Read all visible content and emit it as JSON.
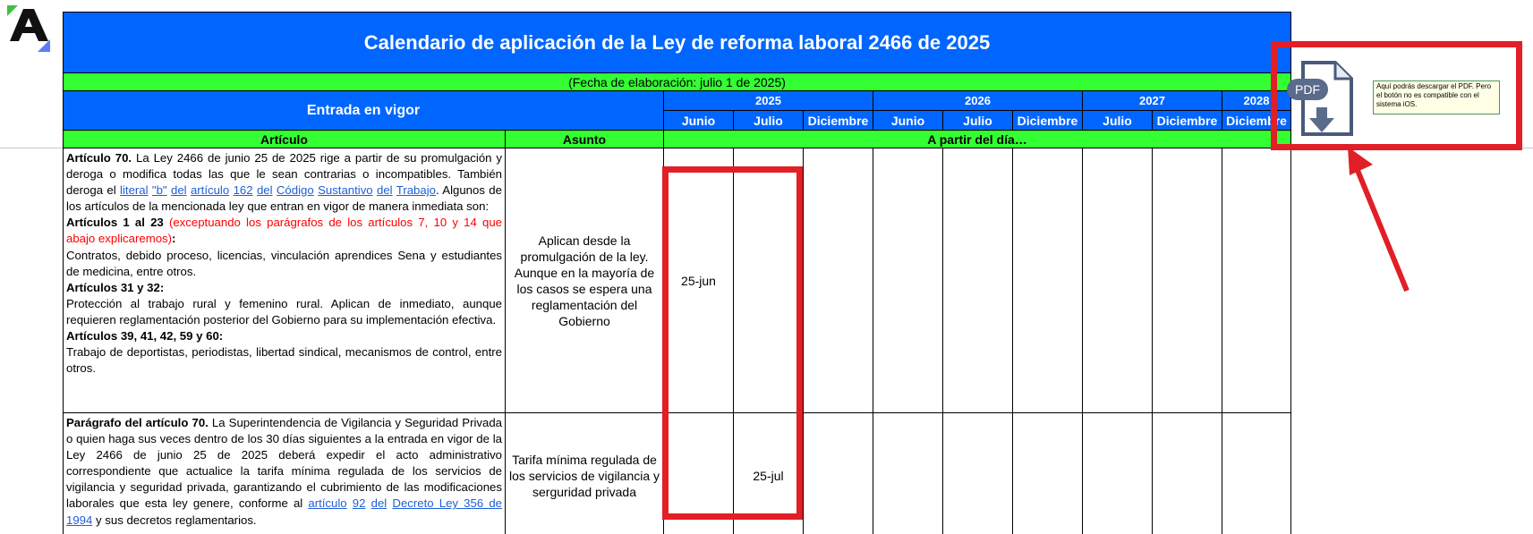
{
  "header": {
    "title": "Calendario de aplicación de la Ley de reforma laboral 2466 de 2025",
    "subtitle": "(Fecha de elaboración: julio 1 de 2025)",
    "entrada_en_vigor": "Entrada en vigor",
    "years": [
      "2025",
      "2026",
      "2027",
      "2028"
    ],
    "months": [
      "Junio",
      "Julio",
      "Diciembre",
      "Junio",
      "Julio",
      "Diciembre",
      "Julio",
      "Diciembre",
      "Diciembre"
    ],
    "col_articulo": "Artículo",
    "col_asunto": "Asunto",
    "col_a_partir": "A partir del día…"
  },
  "rows": [
    {
      "art": {
        "p1_bold": "Artículo 70.",
        "p1_text": " La Ley 2466 de junio 25 de 2025 rige a partir de su promulgación y deroga o modifica todas las que le sean contrarias o incompatibles. También deroga el ",
        "l_literal": "literal",
        "l_b": "\"b\"",
        "l_del": "del",
        "l_articulo": "artículo",
        "l_162": "162",
        "l_del2": "del",
        "l_codigo": "Código",
        "l_sustantivo": "Sustantivo",
        "l_del3": "del",
        "l_trabajo": "Trabajo",
        "p1_tail": ". Algunos de los artículos de la mencionada ley que entran en vigor de manera inmediata son:",
        "a2_bold": "Artículos 1 al 23",
        "a2_red": " (exceptuando los parágrafos de los artículos 7, 10 y 14 que abajo explicaremos)",
        "a2_colon": ":",
        "a2_text": "Contratos, debido proceso, licencias, vinculación aprendices Sena y estudiantes de medicina, entre otros.",
        "a3_bold": "Artículos 31 y 32:",
        "a3_text": "Protección al trabajo rural y femenino rural. Aplican de inmediato, aunque requieren reglamentación posterior del Gobierno para su implementación efectiva.",
        "a4_bold": "Artículos 39, 41, 42, 59 y 60:",
        "a4_text": "Trabajo de deportistas, periodistas, libertad sindical, mecanismos de control, entre otros."
      },
      "asunto": "Aplican desde la promulgación de la ley. Aunque en la mayoría de los casos se espera una reglamentación del Gobierno",
      "junio_2025": "25-jun",
      "julio_2025": ""
    },
    {
      "art": {
        "p_bold": "Parágrafo del artículo 70.",
        "p_text": " La Superintendencia de Vigilancia y Seguridad Privada o quien haga sus veces dentro de los 30 días siguientes a la entrada en vigor de la Ley 2466 de junio 25 de 2025 deberá expedir el acto administrativo correspondiente que actualice la tarifa mínima regulada de los servicios de vigilancia y seguridad privada, garantizando el cubrimiento de las modificaciones laborales que esta ley genere, conforme al ",
        "l_articulo": "artículo",
        "l_92": "92",
        "l_del": "del",
        "l_decreto": "Decreto Ley 356 de 1994",
        "p_tail": " y sus decretos reglamentarios."
      },
      "asunto": "Tarifa mínima regulada de los servicios de vigilancia y serguridad privada",
      "junio_2025": "",
      "julio_2025": "25-jul"
    }
  ],
  "pdf": {
    "icon_label": "PDF",
    "note": "Aquí podrás descargar el PDF. Pero el botón no es compatible con el sistema iOS."
  },
  "colors": {
    "header_blue": "#0066ff",
    "header_green": "#33ff33",
    "highlight_red": "#e21e26",
    "link_blue": "#1f5fd6"
  }
}
